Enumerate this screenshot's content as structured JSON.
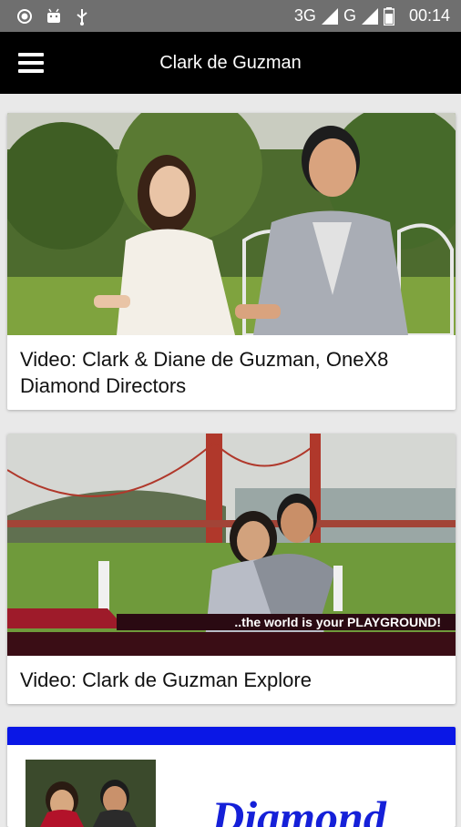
{
  "status_bar": {
    "network_label": "3G",
    "network_label_2": "G",
    "time": "00:14"
  },
  "app_bar": {
    "title": "Clark de Guzman",
    "menu_icon": "hamburger-menu-icon"
  },
  "articles": [
    {
      "title": "Video: Clark & Diane de Guzman, OneX8 Diamond Directors"
    },
    {
      "title": "Video: Clark de Guzman Explore",
      "banner_text": "..the world is your PLAYGROUND!"
    },
    {
      "title_art": "Diamond"
    }
  ],
  "colors": {
    "status_bar_bg": "#6f6f6f",
    "app_bar_bg": "#000000",
    "card3_accent": "#0a17e6",
    "banner_red": "#9e1b2a"
  }
}
